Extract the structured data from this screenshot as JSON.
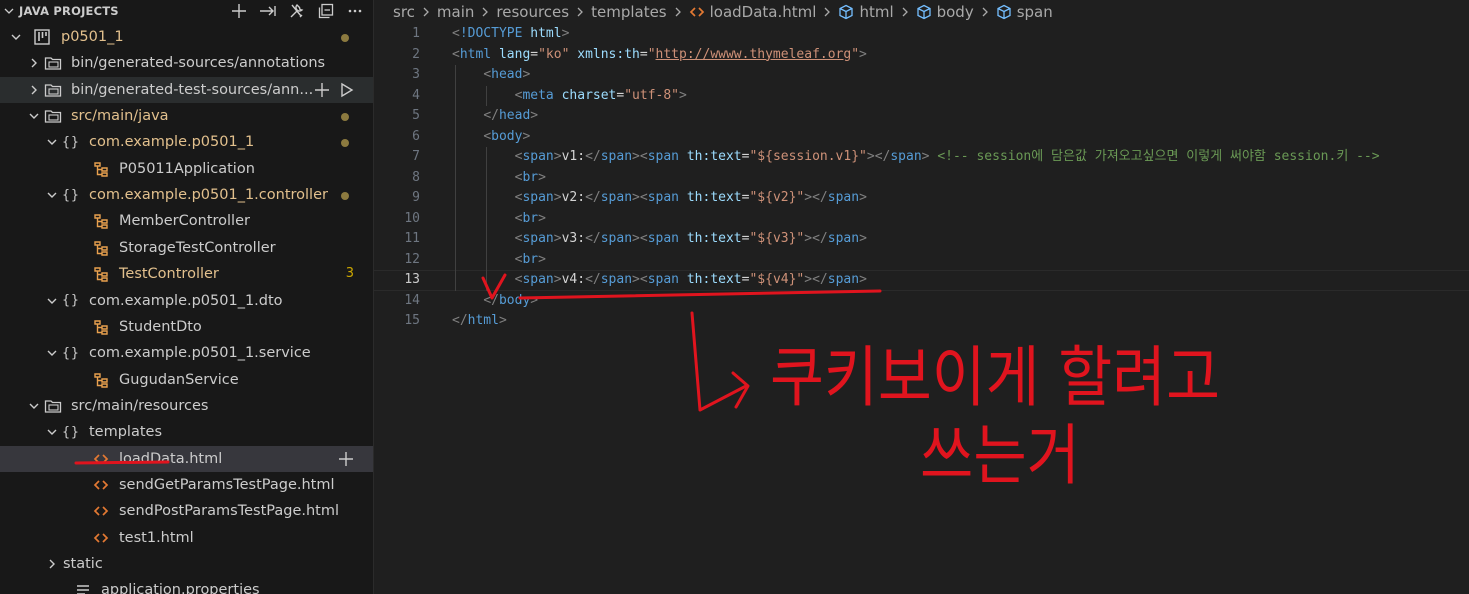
{
  "sidebar": {
    "title": "JAVA PROJECTS",
    "actions": [
      {
        "icon": "add-icon"
      },
      {
        "icon": "export-icon"
      },
      {
        "icon": "tools-icon"
      },
      {
        "icon": "collapse-all-icon"
      },
      {
        "icon": "more-icon"
      }
    ],
    "tree": [
      {
        "label": "p0501_1",
        "icon": "project-icon",
        "twist": "open",
        "indent": 0,
        "status": "dot",
        "modified": true
      },
      {
        "label": "bin/generated-sources/annotations",
        "icon": "folder-icon",
        "twist": "closed",
        "indent": 1
      },
      {
        "label": "bin/generated-test-sources/ann...",
        "icon": "folder-icon",
        "twist": "closed",
        "indent": 1,
        "hovered": true,
        "row_actions": [
          "add-icon",
          "run-icon"
        ]
      },
      {
        "label": "src/main/java",
        "icon": "folder-icon",
        "twist": "open",
        "indent": 1,
        "status": "dot",
        "modified": true
      },
      {
        "label": "com.example.p0501_1",
        "icon": "package-icon",
        "twist": "open",
        "indent": 2,
        "status": "dot",
        "modified": true
      },
      {
        "label": "P05011Application",
        "icon": "class-icon",
        "twist": "none",
        "indent": 3
      },
      {
        "label": "com.example.p0501_1.controller",
        "icon": "package-icon",
        "twist": "open",
        "indent": 2,
        "status": "dot",
        "modified": true
      },
      {
        "label": "MemberController",
        "icon": "class-icon",
        "twist": "none",
        "indent": 3
      },
      {
        "label": "StorageTestController",
        "icon": "class-icon",
        "twist": "none",
        "indent": 3
      },
      {
        "label": "TestController",
        "icon": "class-icon",
        "twist": "none",
        "indent": 3,
        "count": "3",
        "modified": true
      },
      {
        "label": "com.example.p0501_1.dto",
        "icon": "package-icon",
        "twist": "open",
        "indent": 2
      },
      {
        "label": "StudentDto",
        "icon": "class-icon",
        "twist": "none",
        "indent": 3
      },
      {
        "label": "com.example.p0501_1.service",
        "icon": "package-icon",
        "twist": "open",
        "indent": 2
      },
      {
        "label": "GugudanService",
        "icon": "class-icon",
        "twist": "none",
        "indent": 3
      },
      {
        "label": "src/main/resources",
        "icon": "folder-icon",
        "twist": "open",
        "indent": 1
      },
      {
        "label": "templates",
        "icon": "package-icon",
        "twist": "open",
        "indent": 2
      },
      {
        "label": "loadData.html",
        "icon": "html-file-icon",
        "twist": "none",
        "indent": 3,
        "selected": true,
        "row_actions": [
          "add-icon"
        ]
      },
      {
        "label": "sendGetParamsTestPage.html",
        "icon": "html-file-icon",
        "twist": "none",
        "indent": 3
      },
      {
        "label": "sendPostParamsTestPage.html",
        "icon": "html-file-icon",
        "twist": "none",
        "indent": 3
      },
      {
        "label": "test1.html",
        "icon": "html-file-icon",
        "twist": "none",
        "indent": 3
      },
      {
        "label": "static",
        "icon": "none",
        "twist": "closed",
        "indent": 2
      },
      {
        "label": "application.properties",
        "icon": "properties-icon",
        "twist": "none",
        "indent": 2
      }
    ]
  },
  "editor": {
    "breadcrumb": [
      {
        "label": "src",
        "icon": "none"
      },
      {
        "label": "main",
        "icon": "none"
      },
      {
        "label": "resources",
        "icon": "none"
      },
      {
        "label": "templates",
        "icon": "none"
      },
      {
        "label": "loadData.html",
        "icon": "html-file-icon"
      },
      {
        "label": "html",
        "icon": "element-icon"
      },
      {
        "label": "body",
        "icon": "element-icon"
      },
      {
        "label": "span",
        "icon": "element-icon"
      }
    ],
    "current_line": 13,
    "lines": [
      {
        "n": "1",
        "tokens": [
          [
            "t-punc",
            "<"
          ],
          [
            "t-tag",
            "!DOCTYPE"
          ],
          [
            "t-text",
            " "
          ],
          [
            "t-attr",
            "html"
          ],
          [
            "t-punc",
            ">"
          ]
        ]
      },
      {
        "n": "2",
        "tokens": [
          [
            "t-punc",
            "<"
          ],
          [
            "t-tag",
            "html"
          ],
          [
            "t-text",
            " "
          ],
          [
            "t-attr",
            "lang"
          ],
          [
            "t-text",
            "="
          ],
          [
            "t-str",
            "\"ko\""
          ],
          [
            "t-text",
            " "
          ],
          [
            "t-attr",
            "xmlns:th"
          ],
          [
            "t-text",
            "="
          ],
          [
            "t-str",
            "\""
          ],
          [
            "t-link",
            "http://wwww.thymeleaf.org"
          ],
          [
            "t-str",
            "\""
          ],
          [
            "t-punc",
            ">"
          ]
        ]
      },
      {
        "n": "3",
        "tokens": [
          [
            "t-text",
            "    "
          ],
          [
            "t-punc",
            "<"
          ],
          [
            "t-tag",
            "head"
          ],
          [
            "t-punc",
            ">"
          ]
        ]
      },
      {
        "n": "4",
        "tokens": [
          [
            "t-text",
            "        "
          ],
          [
            "t-punc",
            "<"
          ],
          [
            "t-tag",
            "meta"
          ],
          [
            "t-text",
            " "
          ],
          [
            "t-attr",
            "charset"
          ],
          [
            "t-text",
            "="
          ],
          [
            "t-str",
            "\"utf-8\""
          ],
          [
            "t-punc",
            ">"
          ]
        ]
      },
      {
        "n": "5",
        "tokens": [
          [
            "t-text",
            "    "
          ],
          [
            "t-punc",
            "</"
          ],
          [
            "t-tag",
            "head"
          ],
          [
            "t-punc",
            ">"
          ]
        ]
      },
      {
        "n": "6",
        "tokens": [
          [
            "t-text",
            "    "
          ],
          [
            "t-punc",
            "<"
          ],
          [
            "t-tag",
            "body"
          ],
          [
            "t-punc",
            ">"
          ]
        ]
      },
      {
        "n": "7",
        "tokens": [
          [
            "t-text",
            "        "
          ],
          [
            "t-punc",
            "<"
          ],
          [
            "t-tag",
            "span"
          ],
          [
            "t-punc",
            ">"
          ],
          [
            "t-text",
            "v1:"
          ],
          [
            "t-punc",
            "</"
          ],
          [
            "t-tag",
            "span"
          ],
          [
            "t-punc",
            ">"
          ],
          [
            "t-punc",
            "<"
          ],
          [
            "t-tag",
            "span"
          ],
          [
            "t-text",
            " "
          ],
          [
            "t-attr",
            "th:text"
          ],
          [
            "t-text",
            "="
          ],
          [
            "t-str",
            "\"${session.v1}\""
          ],
          [
            "t-punc",
            ">"
          ],
          [
            "t-punc",
            "</"
          ],
          [
            "t-tag",
            "span"
          ],
          [
            "t-punc",
            ">"
          ],
          [
            "t-text",
            " "
          ],
          [
            "t-cmt",
            "<!-- session에 담은값 가져오고싶으면 이렇게 써야함 session.키 -->"
          ]
        ]
      },
      {
        "n": "8",
        "tokens": [
          [
            "t-text",
            "        "
          ],
          [
            "t-punc",
            "<"
          ],
          [
            "t-tag",
            "br"
          ],
          [
            "t-punc",
            ">"
          ]
        ]
      },
      {
        "n": "9",
        "tokens": [
          [
            "t-text",
            "        "
          ],
          [
            "t-punc",
            "<"
          ],
          [
            "t-tag",
            "span"
          ],
          [
            "t-punc",
            ">"
          ],
          [
            "t-text",
            "v2:"
          ],
          [
            "t-punc",
            "</"
          ],
          [
            "t-tag",
            "span"
          ],
          [
            "t-punc",
            ">"
          ],
          [
            "t-punc",
            "<"
          ],
          [
            "t-tag",
            "span"
          ],
          [
            "t-text",
            " "
          ],
          [
            "t-attr",
            "th:text"
          ],
          [
            "t-text",
            "="
          ],
          [
            "t-str",
            "\"${v2}\""
          ],
          [
            "t-punc",
            ">"
          ],
          [
            "t-punc",
            "</"
          ],
          [
            "t-tag",
            "span"
          ],
          [
            "t-punc",
            ">"
          ]
        ]
      },
      {
        "n": "10",
        "tokens": [
          [
            "t-text",
            "        "
          ],
          [
            "t-punc",
            "<"
          ],
          [
            "t-tag",
            "br"
          ],
          [
            "t-punc",
            ">"
          ]
        ]
      },
      {
        "n": "11",
        "tokens": [
          [
            "t-text",
            "        "
          ],
          [
            "t-punc",
            "<"
          ],
          [
            "t-tag",
            "span"
          ],
          [
            "t-punc",
            ">"
          ],
          [
            "t-text",
            "v3:"
          ],
          [
            "t-punc",
            "</"
          ],
          [
            "t-tag",
            "span"
          ],
          [
            "t-punc",
            ">"
          ],
          [
            "t-punc",
            "<"
          ],
          [
            "t-tag",
            "span"
          ],
          [
            "t-text",
            " "
          ],
          [
            "t-attr",
            "th:text"
          ],
          [
            "t-text",
            "="
          ],
          [
            "t-str",
            "\"${v3}\""
          ],
          [
            "t-punc",
            ">"
          ],
          [
            "t-punc",
            "</"
          ],
          [
            "t-tag",
            "span"
          ],
          [
            "t-punc",
            ">"
          ]
        ]
      },
      {
        "n": "12",
        "tokens": [
          [
            "t-text",
            "        "
          ],
          [
            "t-punc",
            "<"
          ],
          [
            "t-tag",
            "br"
          ],
          [
            "t-punc",
            ">"
          ]
        ]
      },
      {
        "n": "13",
        "tokens": [
          [
            "t-text",
            "        "
          ],
          [
            "t-punc",
            "<"
          ],
          [
            "t-tag",
            "span"
          ],
          [
            "t-punc",
            ">"
          ],
          [
            "t-text",
            "v4:"
          ],
          [
            "t-punc",
            "</"
          ],
          [
            "t-tag",
            "span"
          ],
          [
            "t-punc",
            ">"
          ],
          [
            "t-punc",
            "<"
          ],
          [
            "t-tag",
            "span"
          ],
          [
            "t-text",
            " "
          ],
          [
            "t-attr",
            "th:text"
          ],
          [
            "t-text",
            "="
          ],
          [
            "t-str",
            "\"${v4}\""
          ],
          [
            "t-punc",
            ">"
          ],
          [
            "t-punc",
            "</"
          ],
          [
            "t-tag",
            "span"
          ],
          [
            "t-punc",
            ">"
          ]
        ]
      },
      {
        "n": "14",
        "tokens": [
          [
            "t-text",
            "    "
          ],
          [
            "t-punc",
            "</"
          ],
          [
            "t-tag",
            "body"
          ],
          [
            "t-punc",
            ">"
          ]
        ]
      },
      {
        "n": "15",
        "tokens": [
          [
            "t-punc",
            "</"
          ],
          [
            "t-tag",
            "html"
          ],
          [
            "t-punc",
            ">"
          ]
        ]
      }
    ]
  },
  "annotation": {
    "color": "#e0141e",
    "handwritten_line1": "쿠키보이게 할려고",
    "handwritten_line2": "쓰는거"
  }
}
